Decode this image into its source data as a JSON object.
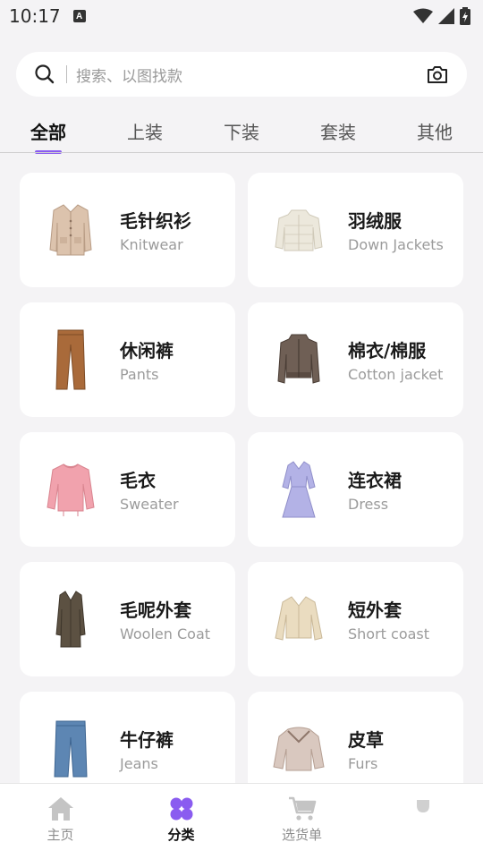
{
  "status_bar": {
    "time": "10:17",
    "badge": "A"
  },
  "search": {
    "placeholder": "搜索、以图找款"
  },
  "tabs": [
    {
      "label": "全部",
      "active": true
    },
    {
      "label": "上装",
      "active": false
    },
    {
      "label": "下装",
      "active": false
    },
    {
      "label": "套装",
      "active": false
    },
    {
      "label": "其他",
      "active": false
    }
  ],
  "categories": [
    {
      "cn": "毛针织衫",
      "en": "Knitwear",
      "icon": "cardigan-icon"
    },
    {
      "cn": "羽绒服",
      "en": "Down Jackets",
      "icon": "down-jacket-icon"
    },
    {
      "cn": "休闲裤",
      "en": "Pants",
      "icon": "pants-icon"
    },
    {
      "cn": "棉衣/棉服",
      "en": "Cotton jacket",
      "icon": "cotton-jacket-icon"
    },
    {
      "cn": "毛衣",
      "en": "Sweater",
      "icon": "sweater-icon"
    },
    {
      "cn": "连衣裙",
      "en": "Dress",
      "icon": "dress-icon"
    },
    {
      "cn": "毛呢外套",
      "en": "Woolen Coat",
      "icon": "woolen-coat-icon"
    },
    {
      "cn": "短外套",
      "en": "Short coast",
      "icon": "short-coat-icon"
    },
    {
      "cn": "牛仔裤",
      "en": "Jeans",
      "icon": "jeans-icon"
    },
    {
      "cn": "皮草",
      "en": "Furs",
      "icon": "fur-icon"
    }
  ],
  "bottom_nav": [
    {
      "label": "主页",
      "icon": "home-icon",
      "active": false
    },
    {
      "label": "分类",
      "icon": "category-icon",
      "active": true
    },
    {
      "label": "选货单",
      "icon": "cart-icon",
      "active": false
    },
    {
      "label": "",
      "icon": "profile-icon",
      "active": false
    }
  ],
  "colors": {
    "accent": "#8a5cf0",
    "background": "#f4f3f5"
  }
}
